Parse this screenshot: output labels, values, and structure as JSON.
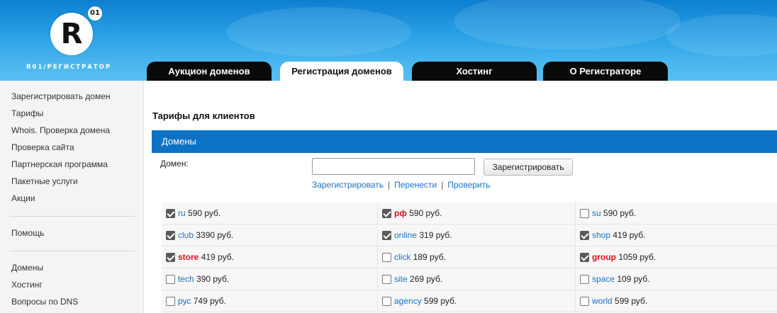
{
  "logo": {
    "letter": "R",
    "badge": "01",
    "text": "R01/РЕГИСТРАТОР"
  },
  "tabs": [
    {
      "label": "Аукцион доменов",
      "active": false
    },
    {
      "label": "Регистрация доменов",
      "active": true
    },
    {
      "label": "Хостинг",
      "active": false
    },
    {
      "label": "О Регистраторе",
      "active": false
    }
  ],
  "sidebar": {
    "group1": [
      "Зарегистрировать домен",
      "Тарифы",
      "Whois. Проверка домена",
      "Проверка сайта",
      "Партнерская программа",
      "Пакетные услуги",
      "Акции"
    ],
    "group2": [
      "Помощь"
    ],
    "group3": [
      "Домены",
      "Хостинг",
      "Вопросы по DNS"
    ]
  },
  "main": {
    "title": "Тарифы для клиентов",
    "section": "Домены",
    "domain_label": "Домен:",
    "domain_input_value": "",
    "register_button": "Зарегистрировать",
    "actions": [
      "Зарегистрировать",
      "Перенести",
      "Проверить"
    ]
  },
  "colors": {
    "accent": "#0c72c4",
    "link": "#1a73c2",
    "hot": "#d8131b"
  },
  "zones": [
    [
      {
        "zone": "ru",
        "price": "590 руб.",
        "checked": true,
        "hot": false
      },
      {
        "zone": "рф",
        "price": "590 руб.",
        "checked": true,
        "hot": true
      },
      {
        "zone": "su",
        "price": "590 руб.",
        "checked": false,
        "hot": false
      }
    ],
    [
      {
        "zone": "club",
        "price": "3390 руб.",
        "checked": true,
        "hot": false
      },
      {
        "zone": "online",
        "price": "319 руб.",
        "checked": true,
        "hot": false
      },
      {
        "zone": "shop",
        "price": "419 руб.",
        "checked": true,
        "hot": false
      }
    ],
    [
      {
        "zone": "store",
        "price": "419 руб.",
        "checked": true,
        "hot": true
      },
      {
        "zone": "click",
        "price": "189 руб.",
        "checked": false,
        "hot": false
      },
      {
        "zone": "group",
        "price": "1059 руб.",
        "checked": true,
        "hot": true
      }
    ],
    [
      {
        "zone": "tech",
        "price": "390 руб.",
        "checked": false,
        "hot": false
      },
      {
        "zone": "site",
        "price": "269 руб.",
        "checked": false,
        "hot": false
      },
      {
        "zone": "space",
        "price": "109 руб.",
        "checked": false,
        "hot": false
      }
    ],
    [
      {
        "zone": "рус",
        "price": "749 руб.",
        "checked": false,
        "hot": false
      },
      {
        "zone": "agency",
        "price": "599 руб.",
        "checked": false,
        "hot": false
      },
      {
        "zone": "world",
        "price": "599 руб.",
        "checked": false,
        "hot": false
      }
    ]
  ]
}
